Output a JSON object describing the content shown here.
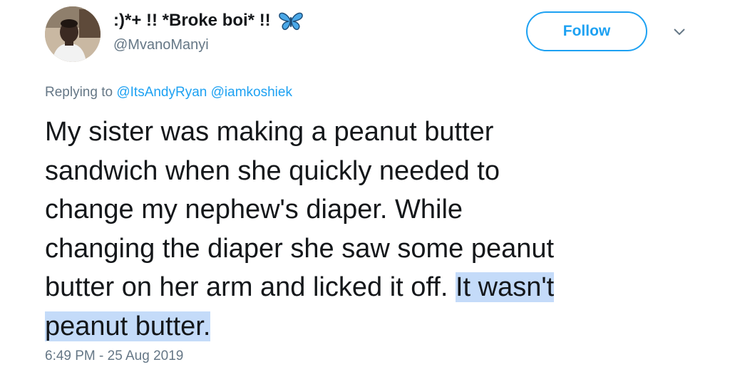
{
  "tweet": {
    "author": {
      "display_name": ":)*+ !! *Broke boi* !!",
      "handle": "@MvanoManyi",
      "emoji_icon": "butterfly-icon"
    },
    "follow_label": "Follow",
    "menu_icon": "chevron-down-icon",
    "reply": {
      "prefix": "Replying to",
      "mentions": [
        "@ItsAndyRyan",
        "@iamkoshiek"
      ]
    },
    "text_lines": [
      "My sister was making a peanut butter",
      "sandwich when she quickly needed to",
      "change my nephew's diaper. While",
      "changing the diaper she saw some peanut",
      "butter on her arm and licked it off.",
      "It wasn't",
      "peanut butter."
    ],
    "highlight_color": "#c4dbf9",
    "timestamp": "6:49 PM - 25 Aug 2019"
  },
  "colors": {
    "accent": "#1da1f2",
    "text": "#14171a",
    "muted": "#657786"
  }
}
